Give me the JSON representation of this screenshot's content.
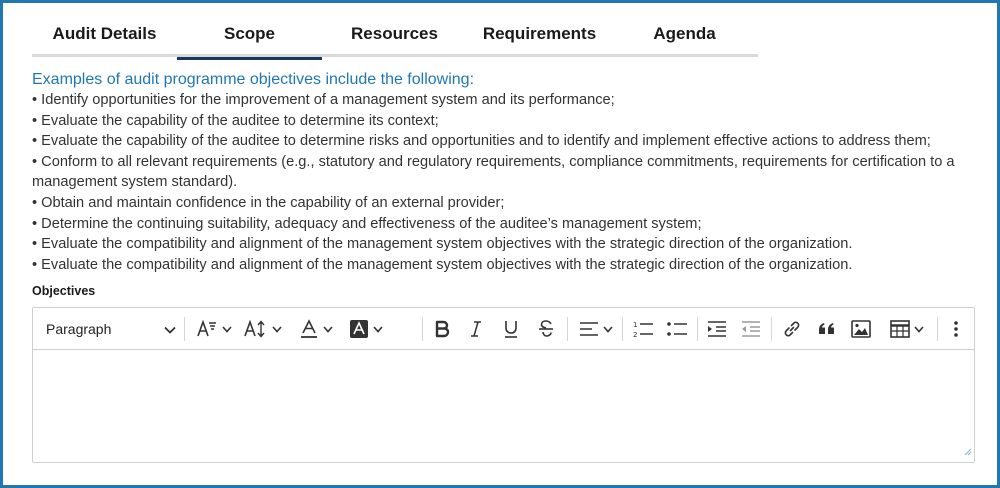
{
  "tabs": [
    {
      "label": "Audit Details",
      "active": false
    },
    {
      "label": "Scope",
      "active": true
    },
    {
      "label": "Resources",
      "active": false
    },
    {
      "label": "Requirements",
      "active": false
    },
    {
      "label": "Agenda",
      "active": false
    }
  ],
  "intro": "Examples of audit programme objectives include the following:",
  "bullets": [
    "• Identify opportunities for the improvement of a management system and its performance;",
    "• Evaluate the capability of the auditee to determine its context;",
    "• Evaluate the capability of the auditee to determine risks and opportunities and to identify and implement effective actions to address them;",
    "• Conform to all relevant requirements (e.g., statutory and regulatory requirements, compliance commitments, requirements for certification to a management system standard).",
    "• Obtain and maintain confidence in the capability of an external provider;",
    "• Determine the continuing suitability, adequacy and effectiveness of the auditee’s management system;",
    "• Evaluate the compatibility and alignment of the management system objectives with the strategic direction of the organization.",
    "• Evaluate the compatibility and alignment of the management system objectives with the strategic direction of the organization."
  ],
  "field_label": "Objectives",
  "editor": {
    "paragraph_select": "Paragraph",
    "value": "",
    "icons": [
      "font-size-icon",
      "line-height-icon",
      "font-color-icon",
      "background-color-icon",
      "bold-icon",
      "italic-icon",
      "underline-icon",
      "strikethrough-icon",
      "align-icon",
      "numbered-list-icon",
      "bulleted-list-icon",
      "indent-icon",
      "outdent-icon",
      "link-icon",
      "blockquote-icon",
      "image-icon",
      "table-icon",
      "more-options-icon"
    ]
  },
  "colors": {
    "accent": "#1f78b4",
    "tab_active_underline": "#17375e",
    "border": "#cfcfcf"
  }
}
